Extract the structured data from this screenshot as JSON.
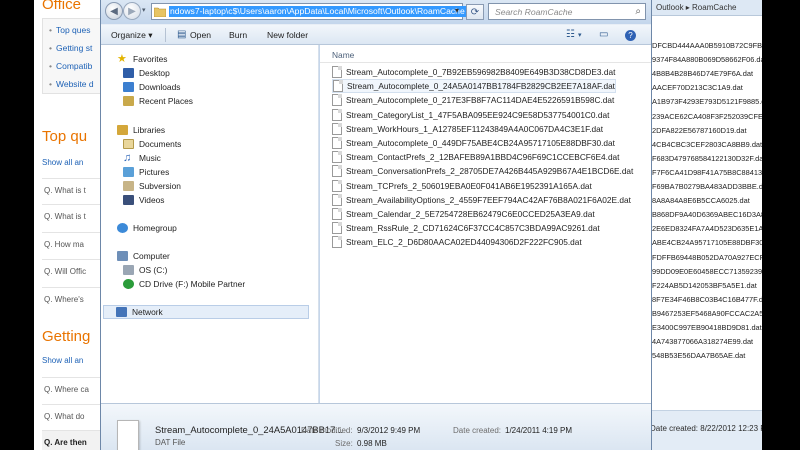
{
  "webpage": {
    "title": "Office",
    "links": [
      "Top ques",
      "Getting st",
      "Compatib",
      "Website d"
    ],
    "top_heading": "Top qu",
    "top_show_all": "Show all an",
    "top_questions": [
      "Q. What is t",
      "Q. What is t",
      "Q. How ma",
      "Q. Will Offic",
      "Q. Where's"
    ],
    "getting_heading": "Getting",
    "getting_show_all": "Show all an",
    "getting_questions": [
      "Q. Where ca",
      "Q. What do"
    ],
    "last_question": "Q. Are then"
  },
  "explorer": {
    "address_path": "ndows7-laptop\\c$\\Users\\aaron\\AppData\\Local\\Microsoft\\Outlook\\RoamCache",
    "search_placeholder": "Search RoamCache",
    "toolbar": {
      "organize": "Organize ▾",
      "open": "Open",
      "burn": "Burn",
      "new_folder": "New folder"
    },
    "nav": {
      "favorites": "Favorites",
      "desktop": "Desktop",
      "downloads": "Downloads",
      "recent_places": "Recent Places",
      "libraries": "Libraries",
      "documents": "Documents",
      "music": "Music",
      "pictures": "Pictures",
      "subversion": "Subversion",
      "videos": "Videos",
      "homegroup": "Homegroup",
      "computer": "Computer",
      "os_c": "OS (C:)",
      "cd_drive": "CD Drive (F:) Mobile Partner",
      "network": "Network"
    },
    "column_name": "Name",
    "files": [
      "Stream_Autocomplete_0_7B92EB596982B8409E649B3D38CD8DE3.dat",
      "Stream_Autocomplete_0_24A5A0147BB1784FB2829CB2EE7A18AF.dat",
      "Stream_Autocomplete_0_217E3FB8F7AC114DAE4E5226591B598C.dat",
      "Stream_CategoryList_1_47F5ABA095EE924C9E58D537754001C0.dat",
      "Stream_WorkHours_1_A12785EF11243849A4A0C067DA4C3E1F.dat",
      "Stream_Autocomplete_0_449DF75ABE4CB24A95717105E88DBF30.dat",
      "Stream_ContactPrefs_2_12BAFEB89A1BBD4C96F69C1CCEBCF6E4.dat",
      "Stream_ConversationPrefs_2_28705DE7A426B445A929B67A4E1BCD6E.dat",
      "Stream_TCPrefs_2_506019EBA0E0F041AB6E1952391A165A.dat",
      "Stream_AvailabilityOptions_2_4559F7EEF794AC42AF76B8A021F6A02E.dat",
      "Stream_Calendar_2_5E7254728EB62479C6E0CCED25A3EA9.dat",
      "Stream_RssRule_2_CD71624C6F37CC4C857C3BDA99AC9261.dat",
      "Stream_ELC_2_D6D80AACA02ED44094306D2F222FC905.dat"
    ],
    "details": {
      "name": "Stream_Autocomplete_0_24A5A0147BB17...",
      "type": "DAT File",
      "date_modified_label": "Date modified:",
      "date_modified": "9/3/2012 9:49 PM",
      "size_label": "Size:",
      "size": "0.98 MB",
      "date_created_label": "Date created:",
      "date_created": "1/24/2011 4:19 PM"
    }
  },
  "background_window": {
    "breadcrumb": "Outlook ▸ RoamCache",
    "rows": [
      "DFCBD444AAA0B5910B72C9FB.dat",
      "9374F84A880B069D58662F06.dat",
      "4B8B4B28B46D74E79F6A.dat",
      "AACEF70D213C3C1A9.dat",
      "A1B973F4293E793D5121F9885.dat",
      "239ACE62CA408F3F252039CFED83.dat",
      "2DFA822E56787160D19.dat",
      "4CB4CBC3CEF2803CA8BB9.dat",
      "F683D479768584122130D32F.dat",
      "F7F6CA41D98F41A75B8C8841325DEC.dat",
      "F69BA7B0279BA483ADD3BBE.dat",
      "8A8A84A8E6B5CCA6025.dat",
      "B868DF9A40D6369ABEC16D3A8A.dat",
      "2E6ED8324FA7A4D523D635E1A1.dat",
      "ABE4CB24A95717105E88DBF30.dat",
      "FDFFB69448B052DA70A927ECF.dat",
      "99DD09E0E60458ECC71359239EB3D.dat",
      "F224AB5D142053BF5A5E1.dat",
      "8F7E34F46B8C03B4C16B477F.dat",
      "B9467253EF5468A90FCCAC2A55029.dat",
      "E3400C997EB90418BD9D81.dat",
      "4A743877066A318274E99.dat",
      "548B53E56DAA7B65AE.dat"
    ],
    "status_text": "Date created: 8/22/2012 12:23 PM"
  }
}
